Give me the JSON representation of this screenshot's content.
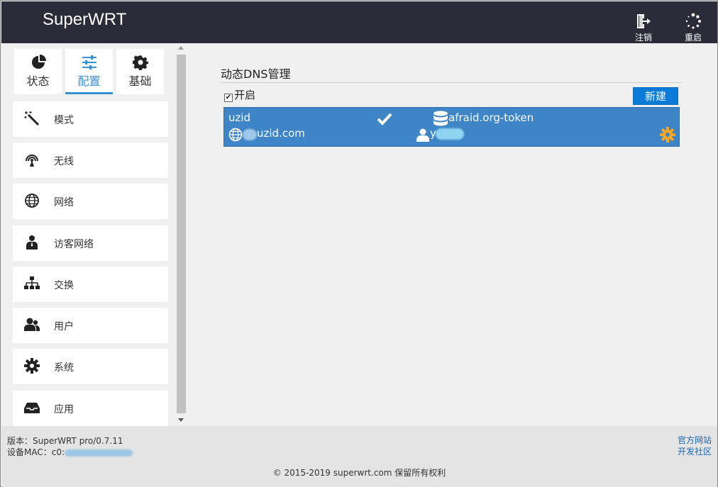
{
  "header": {
    "title": "SuperWRT",
    "logout_label": "注销",
    "reboot_label": "重启"
  },
  "sidebar": {
    "tabs": [
      {
        "label": "状态",
        "icon": "pie-chart-icon"
      },
      {
        "label": "配置",
        "icon": "sliders-icon",
        "active": true
      },
      {
        "label": "基础",
        "icon": "gear-icon"
      }
    ],
    "items": [
      {
        "label": "模式",
        "icon": "magic-wand-icon"
      },
      {
        "label": "无线",
        "icon": "wireless-icon"
      },
      {
        "label": "网络",
        "icon": "globe-icon"
      },
      {
        "label": "访客网络",
        "icon": "guest-user-icon"
      },
      {
        "label": "交换",
        "icon": "network-switch-icon"
      },
      {
        "label": "用户",
        "icon": "users-icon"
      },
      {
        "label": "系统",
        "icon": "gear-icon"
      },
      {
        "label": "应用",
        "icon": "inbox-icon"
      }
    ]
  },
  "main": {
    "section_title": "动态DNS管理",
    "enable_label": "开启",
    "enable_checked": true,
    "new_button_label": "新建",
    "ddns_entries": [
      {
        "name": "uzid",
        "enabled": true,
        "provider": "afraid.org-token",
        "domain": "uzid.com",
        "username": "y"
      }
    ]
  },
  "footer": {
    "version_label": "版本：SuperWRT pro/0.7.11",
    "mac_label": "设备MAC：c0:",
    "official_site": "官方网站",
    "dev_community": "开发社区",
    "copyright": "© 2015-2019 superwrt.com 保留所有权利"
  },
  "colors": {
    "header_bg": "#2b2b3a",
    "accent": "#3a8fd0",
    "row_bg": "#3d85c6",
    "button_bg": "#0a7bd6",
    "gear_orange": "#f5a623"
  }
}
